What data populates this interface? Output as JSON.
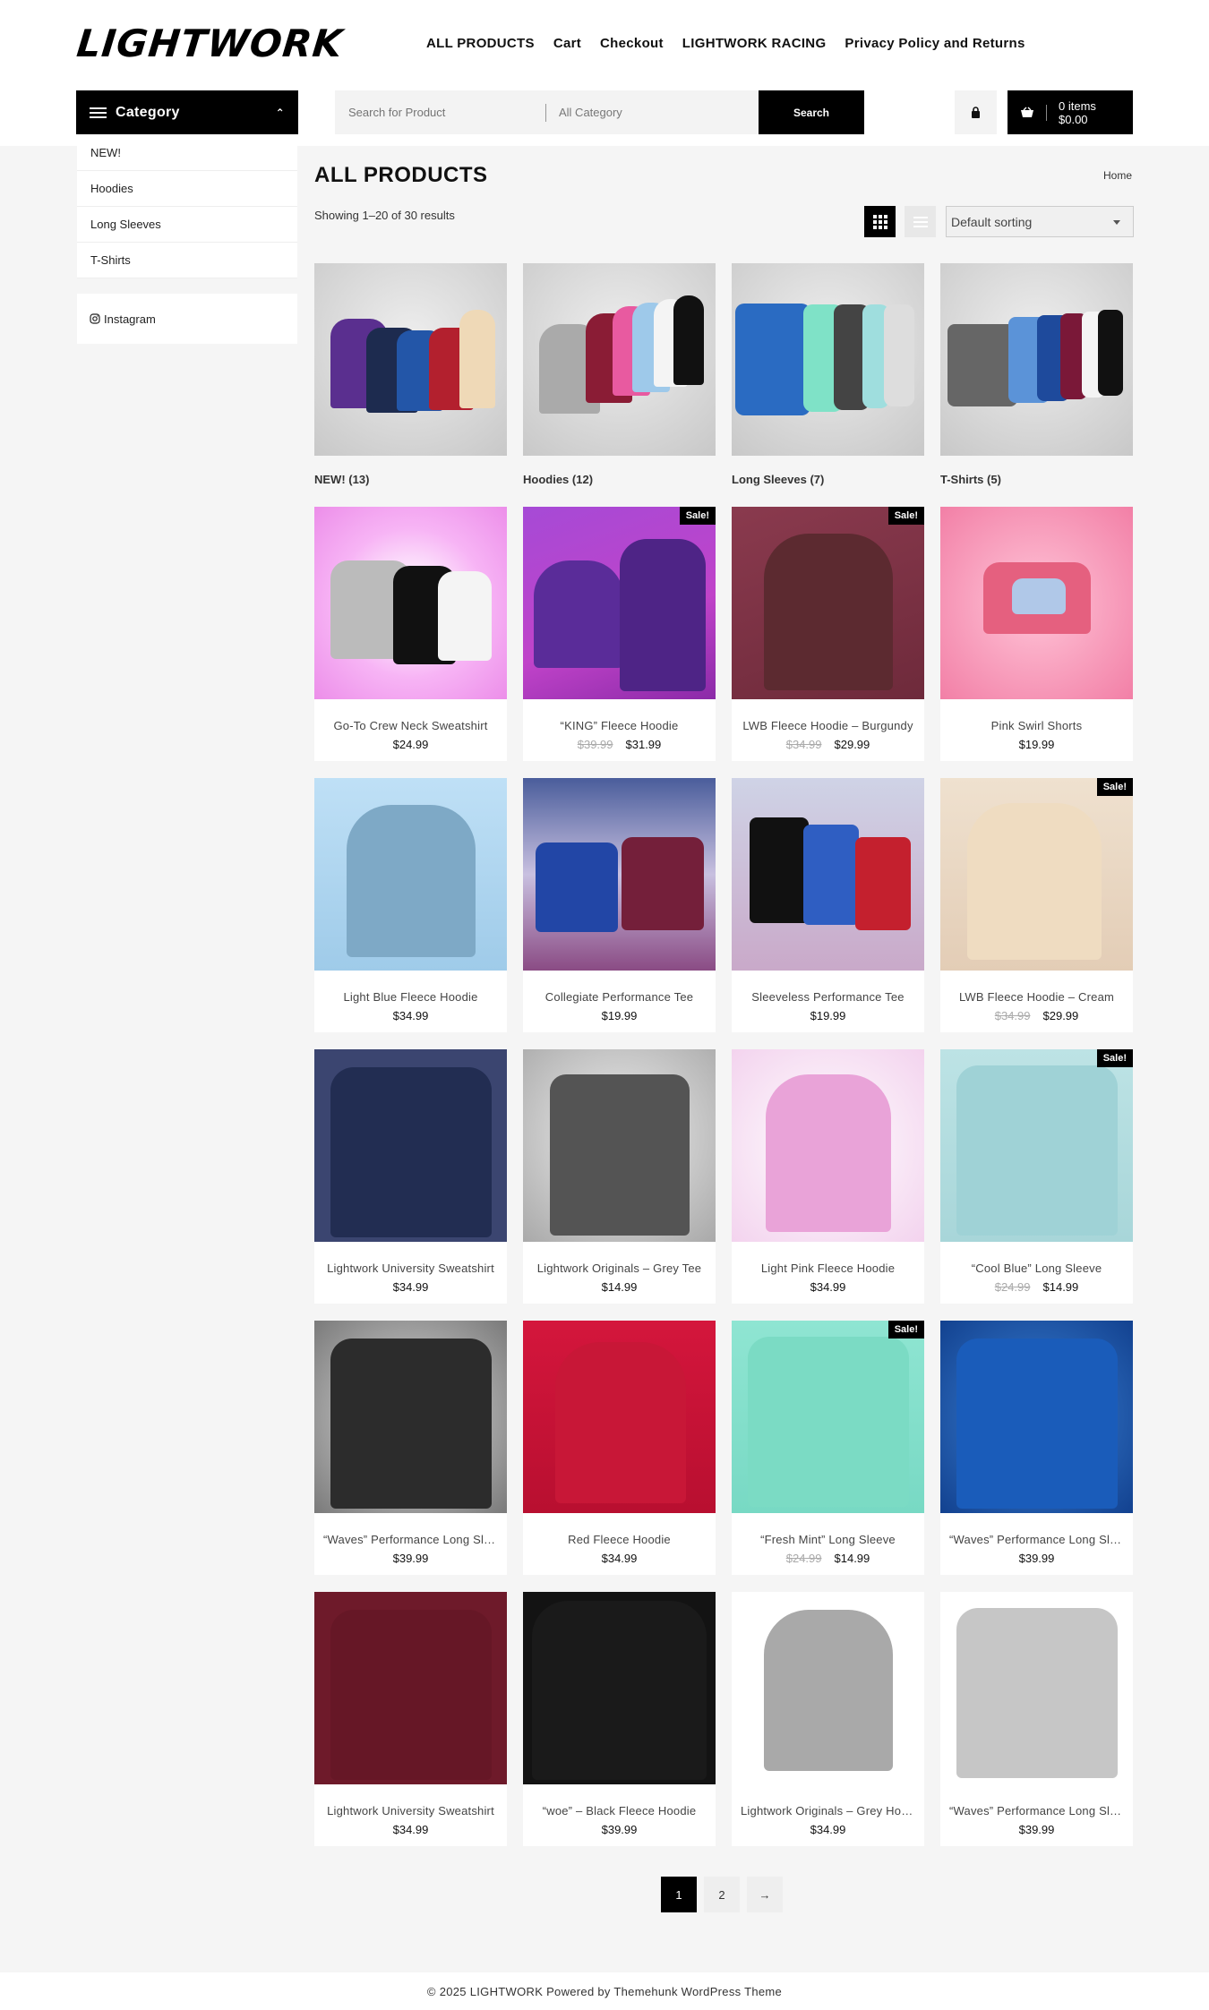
{
  "header": {
    "logo": "LIGHTWORK",
    "nav": [
      "ALL PRODUCTS",
      "Cart",
      "Checkout",
      "LIGHTWORK RACING",
      "Privacy Policy and Returns"
    ],
    "category_button": "Category",
    "search_placeholder": "Search for Product",
    "search_category": "All Category",
    "search_button": "Search",
    "cart_items": "0 items",
    "cart_total": "$0.00"
  },
  "sidebar": {
    "categories": [
      "NEW!",
      "Hoodies",
      "Long Sleeves",
      "T-Shirts"
    ],
    "instagram": "Instagram"
  },
  "main": {
    "title": "ALL PRODUCTS",
    "breadcrumb": "Home",
    "result_count": "Showing 1–20 of 30 results",
    "sorting": "Default sorting"
  },
  "category_tiles": [
    {
      "name": "NEW!",
      "count": "(13)"
    },
    {
      "name": "Hoodies",
      "count": "(12)"
    },
    {
      "name": "Long Sleeves",
      "count": "(7)"
    },
    {
      "name": "T-Shirts",
      "count": "(5)"
    }
  ],
  "products": [
    {
      "name": "Go-To Crew Neck Sweatshirt",
      "price": "$24.99",
      "old": "",
      "sale": ""
    },
    {
      "name": "“KING” Fleece Hoodie",
      "price": "$31.99",
      "old": "$39.99",
      "sale": "Sale!"
    },
    {
      "name": "LWB Fleece Hoodie – Burgundy",
      "price": "$29.99",
      "old": "$34.99",
      "sale": "Sale!"
    },
    {
      "name": "Pink Swirl Shorts",
      "price": "$19.99",
      "old": "",
      "sale": ""
    },
    {
      "name": "Light Blue Fleece Hoodie",
      "price": "$34.99",
      "old": "",
      "sale": ""
    },
    {
      "name": "Collegiate Performance Tee",
      "price": "$19.99",
      "old": "",
      "sale": ""
    },
    {
      "name": "Sleeveless Performance Tee",
      "price": "$19.99",
      "old": "",
      "sale": ""
    },
    {
      "name": "LWB Fleece Hoodie – Cream",
      "price": "$29.99",
      "old": "$34.99",
      "sale": "Sale!"
    },
    {
      "name": "Lightwork University Sweatshirt",
      "price": "$34.99",
      "old": "",
      "sale": ""
    },
    {
      "name": "Lightwork Originals – Grey Tee",
      "price": "$14.99",
      "old": "",
      "sale": ""
    },
    {
      "name": "Light Pink Fleece Hoodie",
      "price": "$34.99",
      "old": "",
      "sale": ""
    },
    {
      "name": "“Cool Blue” Long Sleeve",
      "price": "$14.99",
      "old": "$24.99",
      "sale": "Sale!"
    },
    {
      "name": "“Waves” Performance Long Sleeve",
      "price": "$39.99",
      "old": "",
      "sale": ""
    },
    {
      "name": "Red Fleece Hoodie",
      "price": "$34.99",
      "old": "",
      "sale": ""
    },
    {
      "name": "“Fresh Mint” Long Sleeve",
      "price": "$14.99",
      "old": "$24.99",
      "sale": "Sale!"
    },
    {
      "name": "“Waves” Performance Long Sleeve",
      "price": "$39.99",
      "old": "",
      "sale": ""
    },
    {
      "name": "Lightwork University Sweatshirt",
      "price": "$34.99",
      "old": "",
      "sale": ""
    },
    {
      "name": "“woe” – Black Fleece Hoodie",
      "price": "$39.99",
      "old": "",
      "sale": ""
    },
    {
      "name": "Lightwork Originals – Grey Hoodie",
      "price": "$34.99",
      "old": "",
      "sale": ""
    },
    {
      "name": "“Waves” Performance Long Sleeve",
      "price": "$39.99",
      "old": "",
      "sale": ""
    }
  ],
  "pagination": {
    "current": "1",
    "next_page": "2",
    "next": "→"
  },
  "footer": "© 2025 LIGHTWORK Powered by Themehunk WordPress Theme",
  "icons": {
    "menu": "hamburger-icon",
    "caret": "chevron-up-icon",
    "lock": "lock-icon",
    "cart": "basket-icon",
    "instagram": "instagram-icon",
    "grid": "grid-view-icon",
    "list": "list-view-icon"
  },
  "colors": {
    "accent": "#000000",
    "background": "#f5f5f5",
    "sale_badge": "#000000"
  }
}
